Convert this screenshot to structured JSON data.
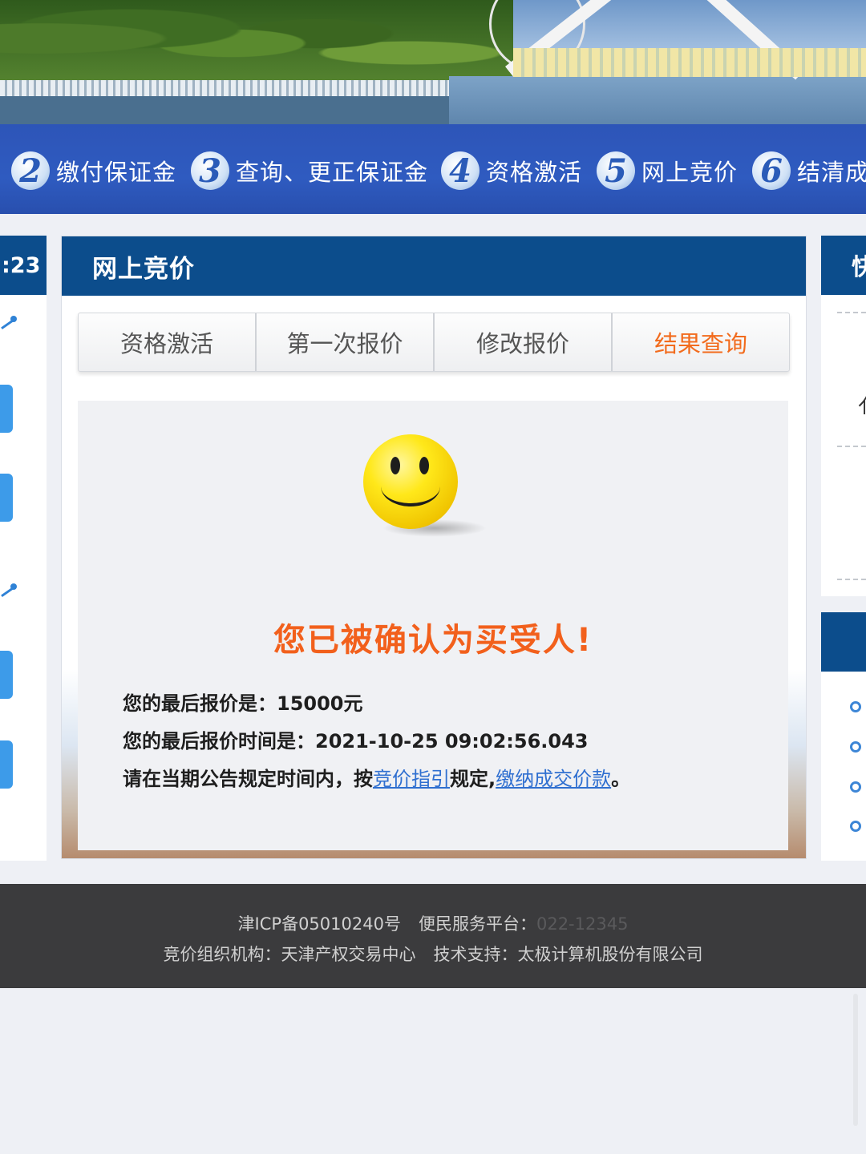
{
  "process_nav": {
    "steps": [
      {
        "number": "2",
        "label": "缴付保证金"
      },
      {
        "number": "3",
        "label": "查询、更正保证金"
      },
      {
        "number": "4",
        "label": "资格激活"
      },
      {
        "number": "5",
        "label": "网上竞价"
      },
      {
        "number": "6",
        "label": "结清成"
      }
    ]
  },
  "left_panel": {
    "clock_fragment": ":23"
  },
  "main_panel": {
    "title": "网上竞价",
    "tabs": [
      {
        "label": "资格激活",
        "active": false
      },
      {
        "label": "第一次报价",
        "active": false
      },
      {
        "label": "修改报价",
        "active": false
      },
      {
        "label": "结果查询",
        "active": true
      }
    ],
    "result": {
      "headline": "您已被确认为买受人!",
      "price_prefix": "您的最后报价是：",
      "price_value": "15000元",
      "time_prefix": "您的最后报价时间是：",
      "time_value": "2021-10-25 09:02:56.043",
      "notice_prefix": "请在当期公告规定时间内，按",
      "notice_link1": "竞价指引",
      "notice_mid": "规定,",
      "notice_link2": "缴纳成交价款",
      "notice_suffix": "。"
    }
  },
  "right_panel": {
    "title_fragment": "快",
    "text_fragment": "亻"
  },
  "footer": {
    "icp": "津ICP备05010240号",
    "service_label": "便民服务平台：",
    "service_phone": "022-12345",
    "organizer": "竞价组织机构：天津产权交易中心",
    "support": "技术支持：太极计算机股份有限公司"
  },
  "colors": {
    "nav_bg": "#2d55b8",
    "header_bg": "#0c4d8c",
    "accent_orange": "#f26b1d",
    "link_blue": "#2f6fd0",
    "footer_bg": "#3b3b3d"
  }
}
